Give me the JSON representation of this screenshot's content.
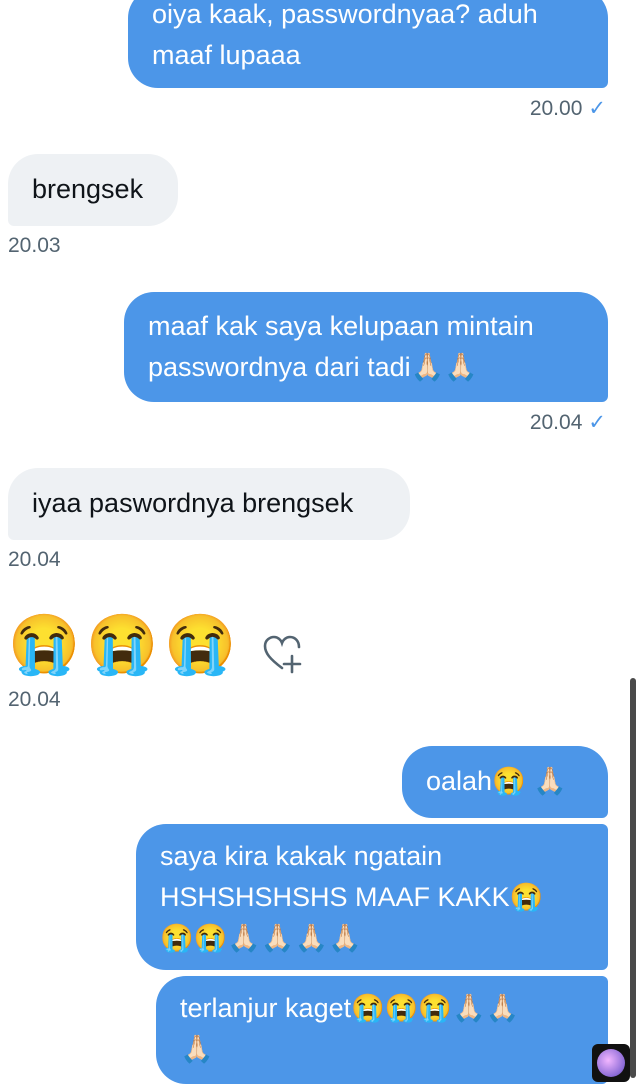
{
  "messages": [
    {
      "dir": "out",
      "lines": [
        "oiya kaak, passwordnyaa? aduh",
        "maaf lupaaa"
      ],
      "time": "20.00"
    },
    {
      "dir": "in",
      "lines": [
        "brengsek"
      ],
      "time": "20.03"
    },
    {
      "dir": "out",
      "lines": [
        "maaf kak saya kelupaan mintain",
        "passwordnya dari tadi🙏🏻🙏🏻"
      ],
      "time": "20.04"
    },
    {
      "dir": "in",
      "lines": [
        "iyaa paswordnya brengsek"
      ],
      "time": "20.04"
    },
    {
      "dir": "in-emoji",
      "emojis": "😭😭😭",
      "time": "20.04"
    },
    {
      "dir": "out",
      "lines": [
        "oalah😭 🙏🏻"
      ]
    },
    {
      "dir": "out",
      "lines": [
        "saya kira kakak ngatain",
        "HSHSHSHSHS MAAF KAKK😭",
        "😭😭🙏🏻🙏🏻🙏🏻🙏🏻"
      ]
    },
    {
      "dir": "out",
      "lines": [
        "terlanjur kaget😭😭😭🙏🏻🙏🏻",
        "🙏🏻"
      ]
    }
  ],
  "icons": {
    "read_receipt": "check-icon",
    "react": "heart-plus-icon",
    "avatar": "avatar-icon"
  },
  "colors": {
    "outgoing": "#4c96e8",
    "incoming": "#eef1f4",
    "timestamp": "#536471"
  }
}
